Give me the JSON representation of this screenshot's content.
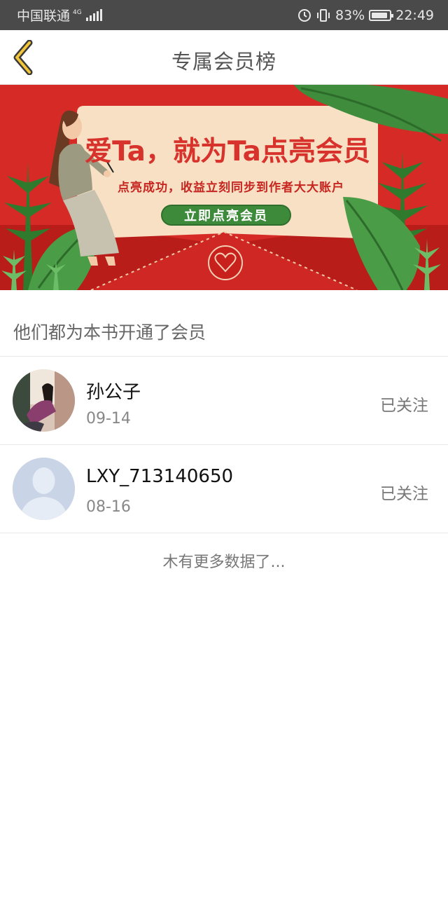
{
  "status_bar": {
    "carrier": "中国联通",
    "network": "4G",
    "battery": "83%",
    "time": "22:49"
  },
  "header": {
    "back_icon": "chevron-left-icon",
    "title": "专属会员榜"
  },
  "banner": {
    "headline": "爱Ta，就为Ta点亮会员",
    "subtitle": "点亮成功，收益立刻同步到作者大大账户",
    "cta_label": "立即点亮会员",
    "colors": {
      "background": "#d62a26",
      "card": "#f7e0c3",
      "cta": "#3d8a3a"
    }
  },
  "section": {
    "label": "他们都为本书开通了会员"
  },
  "members": [
    {
      "name": "孙公子",
      "date": "09-14",
      "status": "已关注",
      "avatar": "photo-avatar"
    },
    {
      "name": "LXY_713140650",
      "date": "08-16",
      "status": "已关注",
      "avatar": "default-user-icon"
    }
  ],
  "footer": {
    "no_more": "木有更多数据了..."
  }
}
